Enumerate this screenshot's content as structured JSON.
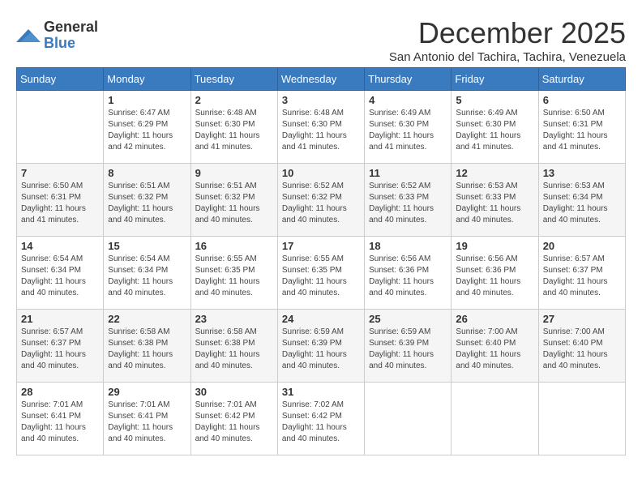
{
  "logo": {
    "general": "General",
    "blue": "Blue"
  },
  "title": "December 2025",
  "location": "San Antonio del Tachira, Tachira, Venezuela",
  "weekdays": [
    "Sunday",
    "Monday",
    "Tuesday",
    "Wednesday",
    "Thursday",
    "Friday",
    "Saturday"
  ],
  "weeks": [
    [
      {
        "day": "",
        "info": ""
      },
      {
        "day": "1",
        "info": "Sunrise: 6:47 AM\nSunset: 6:29 PM\nDaylight: 11 hours\nand 42 minutes."
      },
      {
        "day": "2",
        "info": "Sunrise: 6:48 AM\nSunset: 6:30 PM\nDaylight: 11 hours\nand 41 minutes."
      },
      {
        "day": "3",
        "info": "Sunrise: 6:48 AM\nSunset: 6:30 PM\nDaylight: 11 hours\nand 41 minutes."
      },
      {
        "day": "4",
        "info": "Sunrise: 6:49 AM\nSunset: 6:30 PM\nDaylight: 11 hours\nand 41 minutes."
      },
      {
        "day": "5",
        "info": "Sunrise: 6:49 AM\nSunset: 6:30 PM\nDaylight: 11 hours\nand 41 minutes."
      },
      {
        "day": "6",
        "info": "Sunrise: 6:50 AM\nSunset: 6:31 PM\nDaylight: 11 hours\nand 41 minutes."
      }
    ],
    [
      {
        "day": "7",
        "info": "Sunrise: 6:50 AM\nSunset: 6:31 PM\nDaylight: 11 hours\nand 41 minutes."
      },
      {
        "day": "8",
        "info": "Sunrise: 6:51 AM\nSunset: 6:32 PM\nDaylight: 11 hours\nand 40 minutes."
      },
      {
        "day": "9",
        "info": "Sunrise: 6:51 AM\nSunset: 6:32 PM\nDaylight: 11 hours\nand 40 minutes."
      },
      {
        "day": "10",
        "info": "Sunrise: 6:52 AM\nSunset: 6:32 PM\nDaylight: 11 hours\nand 40 minutes."
      },
      {
        "day": "11",
        "info": "Sunrise: 6:52 AM\nSunset: 6:33 PM\nDaylight: 11 hours\nand 40 minutes."
      },
      {
        "day": "12",
        "info": "Sunrise: 6:53 AM\nSunset: 6:33 PM\nDaylight: 11 hours\nand 40 minutes."
      },
      {
        "day": "13",
        "info": "Sunrise: 6:53 AM\nSunset: 6:34 PM\nDaylight: 11 hours\nand 40 minutes."
      }
    ],
    [
      {
        "day": "14",
        "info": "Sunrise: 6:54 AM\nSunset: 6:34 PM\nDaylight: 11 hours\nand 40 minutes."
      },
      {
        "day": "15",
        "info": "Sunrise: 6:54 AM\nSunset: 6:34 PM\nDaylight: 11 hours\nand 40 minutes."
      },
      {
        "day": "16",
        "info": "Sunrise: 6:55 AM\nSunset: 6:35 PM\nDaylight: 11 hours\nand 40 minutes."
      },
      {
        "day": "17",
        "info": "Sunrise: 6:55 AM\nSunset: 6:35 PM\nDaylight: 11 hours\nand 40 minutes."
      },
      {
        "day": "18",
        "info": "Sunrise: 6:56 AM\nSunset: 6:36 PM\nDaylight: 11 hours\nand 40 minutes."
      },
      {
        "day": "19",
        "info": "Sunrise: 6:56 AM\nSunset: 6:36 PM\nDaylight: 11 hours\nand 40 minutes."
      },
      {
        "day": "20",
        "info": "Sunrise: 6:57 AM\nSunset: 6:37 PM\nDaylight: 11 hours\nand 40 minutes."
      }
    ],
    [
      {
        "day": "21",
        "info": "Sunrise: 6:57 AM\nSunset: 6:37 PM\nDaylight: 11 hours\nand 40 minutes."
      },
      {
        "day": "22",
        "info": "Sunrise: 6:58 AM\nSunset: 6:38 PM\nDaylight: 11 hours\nand 40 minutes."
      },
      {
        "day": "23",
        "info": "Sunrise: 6:58 AM\nSunset: 6:38 PM\nDaylight: 11 hours\nand 40 minutes."
      },
      {
        "day": "24",
        "info": "Sunrise: 6:59 AM\nSunset: 6:39 PM\nDaylight: 11 hours\nand 40 minutes."
      },
      {
        "day": "25",
        "info": "Sunrise: 6:59 AM\nSunset: 6:39 PM\nDaylight: 11 hours\nand 40 minutes."
      },
      {
        "day": "26",
        "info": "Sunrise: 7:00 AM\nSunset: 6:40 PM\nDaylight: 11 hours\nand 40 minutes."
      },
      {
        "day": "27",
        "info": "Sunrise: 7:00 AM\nSunset: 6:40 PM\nDaylight: 11 hours\nand 40 minutes."
      }
    ],
    [
      {
        "day": "28",
        "info": "Sunrise: 7:01 AM\nSunset: 6:41 PM\nDaylight: 11 hours\nand 40 minutes."
      },
      {
        "day": "29",
        "info": "Sunrise: 7:01 AM\nSunset: 6:41 PM\nDaylight: 11 hours\nand 40 minutes."
      },
      {
        "day": "30",
        "info": "Sunrise: 7:01 AM\nSunset: 6:42 PM\nDaylight: 11 hours\nand 40 minutes."
      },
      {
        "day": "31",
        "info": "Sunrise: 7:02 AM\nSunset: 6:42 PM\nDaylight: 11 hours\nand 40 minutes."
      },
      {
        "day": "",
        "info": ""
      },
      {
        "day": "",
        "info": ""
      },
      {
        "day": "",
        "info": ""
      }
    ]
  ]
}
